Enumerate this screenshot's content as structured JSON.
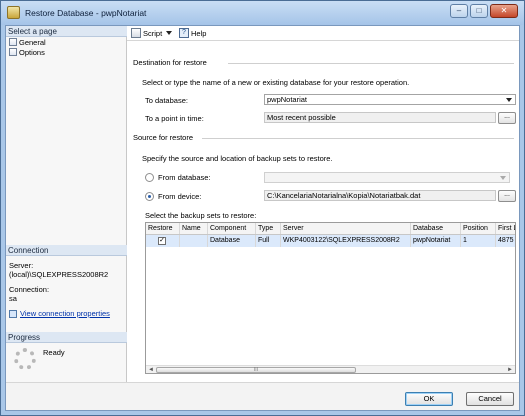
{
  "window": {
    "title": "Restore Database - pwpNotariat",
    "buttons": [
      "–",
      "□",
      "✕"
    ]
  },
  "sidebar": {
    "select_page_label": "Select a page",
    "pages": [
      {
        "label": "General",
        "icon": "page-icon"
      },
      {
        "label": "Options",
        "icon": "page-icon"
      }
    ],
    "connection": {
      "header": "Connection",
      "server_label": "Server:",
      "server_value": "(local)\\SQLEXPRESS2008R2",
      "connection_label": "Connection:",
      "connection_value": "sa",
      "link_label": "View connection properties"
    },
    "progress": {
      "header": "Progress",
      "status": "Ready"
    }
  },
  "toolbar": {
    "script_label": "Script",
    "help_label": "Help"
  },
  "destination": {
    "header": "Destination for restore",
    "description": "Select or type the name of a new or existing database for your restore operation.",
    "to_database_label": "To database:",
    "to_database_value": "pwpNotariat",
    "point_in_time_label": "To a point in time:",
    "point_in_time_value": "Most recent possible",
    "ellipsis": "..."
  },
  "source": {
    "header": "Source for restore",
    "description": "Specify the source and location of backup sets to restore.",
    "from_database_label": "From database:",
    "from_database_value": "",
    "from_device_label": "From device:",
    "from_device_value": "C:\\KancelariaNotarialna\\Kopia\\Notariatbak.dat",
    "selected_option": "From device",
    "ellipsis": "..."
  },
  "backup_sets": {
    "label": "Select the backup sets to restore:",
    "columns": [
      "Restore",
      "Name",
      "Component",
      "Type",
      "Server",
      "Database",
      "Position",
      "First L"
    ],
    "rows": [
      {
        "restore": "✓",
        "name": "",
        "component": "Database",
        "type": "Full",
        "server": "WKP4003122\\SQLEXPRESS2008R2",
        "database": "pwpNotariat",
        "position": "1",
        "first_lsn": "4875"
      }
    ],
    "scroll_left": "◄",
    "scroll_right": "►",
    "scroll_grip": "III"
  },
  "footer": {
    "ok_label": "OK",
    "cancel_label": "Cancel"
  }
}
